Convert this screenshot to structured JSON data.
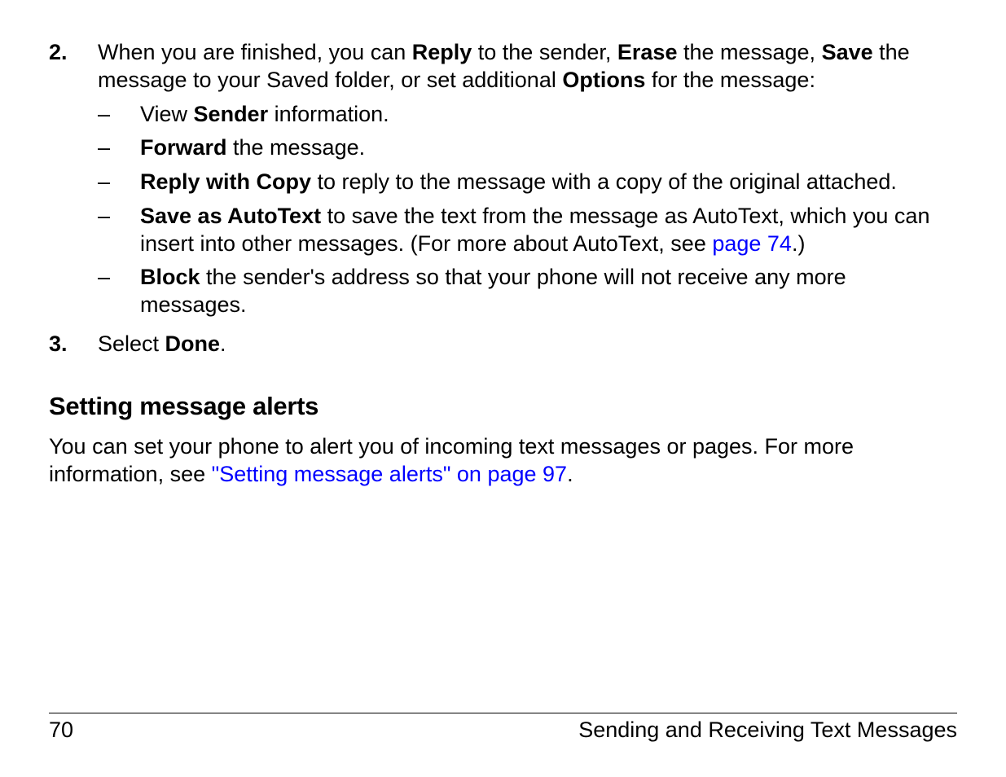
{
  "step2": {
    "num": "2.",
    "t1": "When you are finished, you can ",
    "b1": "Reply",
    "t2": " to the sender, ",
    "b2": "Erase",
    "t3": " the message, ",
    "b3": "Save",
    "t4": " the message to your Saved folder, or set additional ",
    "b4": "Options",
    "t5": " for the message:"
  },
  "dash": "–",
  "sub": {
    "a": {
      "t1": "View ",
      "b1": "Sender",
      "t2": " information."
    },
    "b": {
      "b1": "Forward",
      "t1": " the message."
    },
    "c": {
      "b1": "Reply with Copy",
      "t1": " to reply to the message with a copy of the original attached."
    },
    "d": {
      "b1": "Save as AutoText",
      "t1": " to save the text from the message as AutoText, which you can insert into other messages. (For more about AutoText, see ",
      "link": "page 74",
      "t2": ".)"
    },
    "e": {
      "b1": "Block",
      "t1": " the sender's address so that your phone will not receive any more messages."
    }
  },
  "step3": {
    "num": "3.",
    "t1": "Select ",
    "b1": "Done",
    "t2": "."
  },
  "heading": "Setting message alerts",
  "para": {
    "t1": "You can set your phone to alert you of incoming text messages or pages. For more information, see ",
    "link": "\"Setting message alerts\" on page 97",
    "t2": "."
  },
  "footer": {
    "page": "70",
    "title": "Sending and Receiving Text Messages"
  }
}
